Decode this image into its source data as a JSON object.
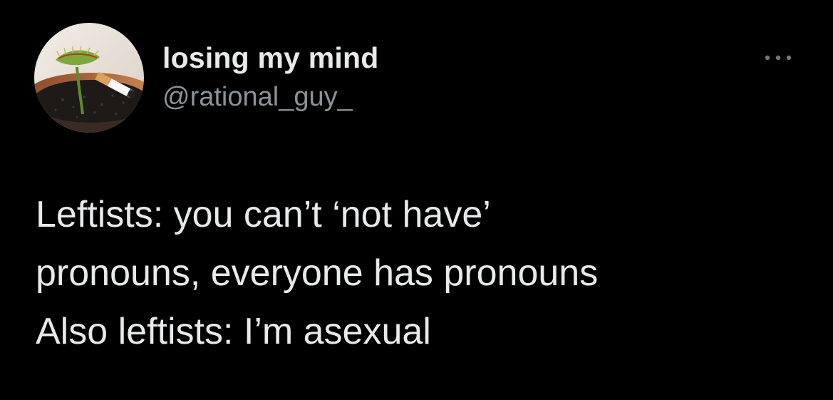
{
  "author": {
    "display_name": "losing my mind",
    "handle": "@rational_guy_",
    "avatar_icon": "venus-flytrap-with-cigarette-avatar"
  },
  "menu": {
    "icon": "more-dots-icon"
  },
  "tweet": {
    "lines": [
      "Leftists: you can’t ‘not have’",
      "pronouns, everyone has pronouns",
      "Also leftists: I’m asexual"
    ]
  },
  "colors": {
    "background": "#000000",
    "primary_text": "#e7e9ea",
    "secondary_text": "#8b9299"
  }
}
